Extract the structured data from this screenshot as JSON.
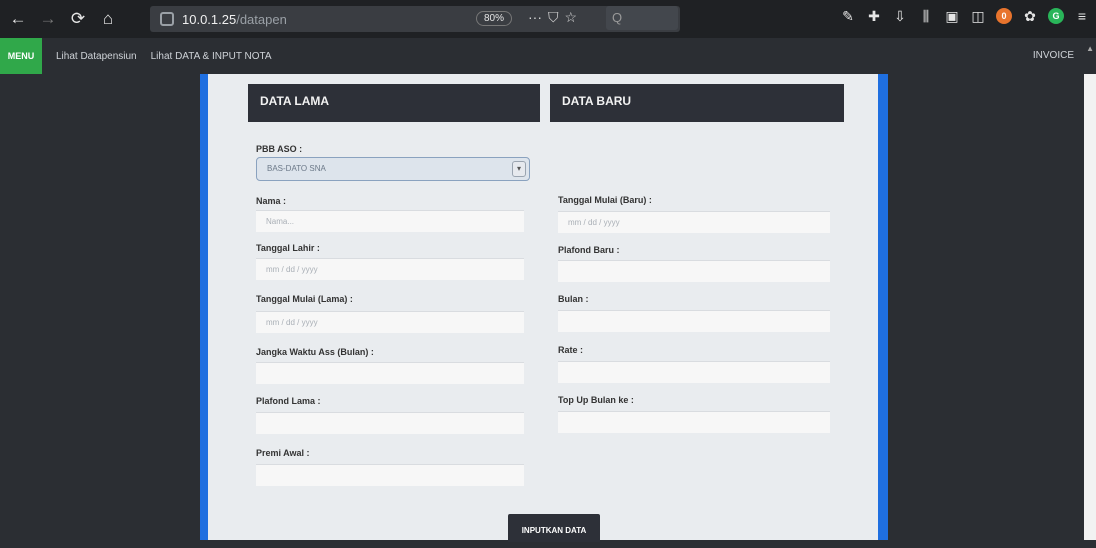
{
  "browser": {
    "url_host": "10.0.1.25",
    "url_path": "/datapen",
    "zoom": "80%",
    "page_actions": "···",
    "search_placeholder": "Q",
    "orange_badge": "0",
    "green_badge": "G"
  },
  "navbar": {
    "brand": "MENU",
    "links": [
      "Lihat Datapensiun",
      "Lihat DATA & INPUT NOTA"
    ],
    "right_link": "INVOICE"
  },
  "data_lama": {
    "title": "DATA LAMA",
    "pbb_label": "PBB ASO :",
    "pbb_selected": "BAS-DATO SNA",
    "nama_label": "Nama :",
    "nama_placeholder": "Nama...",
    "tgl_lahir_label": "Tanggal Lahir :",
    "tgl_lahir_placeholder": "mm / dd / yyyy",
    "tgl_mulai_lama_label": "Tanggal Mulai (Lama) :",
    "tgl_mulai_lama_placeholder": "mm / dd / yyyy",
    "jangka_label": "Jangka Waktu Ass (Bulan) :",
    "plafond_lama_label": "Plafond Lama :",
    "premi_label": "Premi Awal :"
  },
  "data_baru": {
    "title": "DATA BARU",
    "tgl_mulai_baru_label": "Tanggal Mulai (Baru) :",
    "tgl_mulai_baru_placeholder": "mm / dd / yyyy",
    "plafond_baru_label": "Plafond Baru :",
    "bulan_label": "Bulan :",
    "rate_label": "Rate :",
    "top_up_label": "Top Up Bulan ke :"
  },
  "submit_label": "INPUTKAN DATA"
}
